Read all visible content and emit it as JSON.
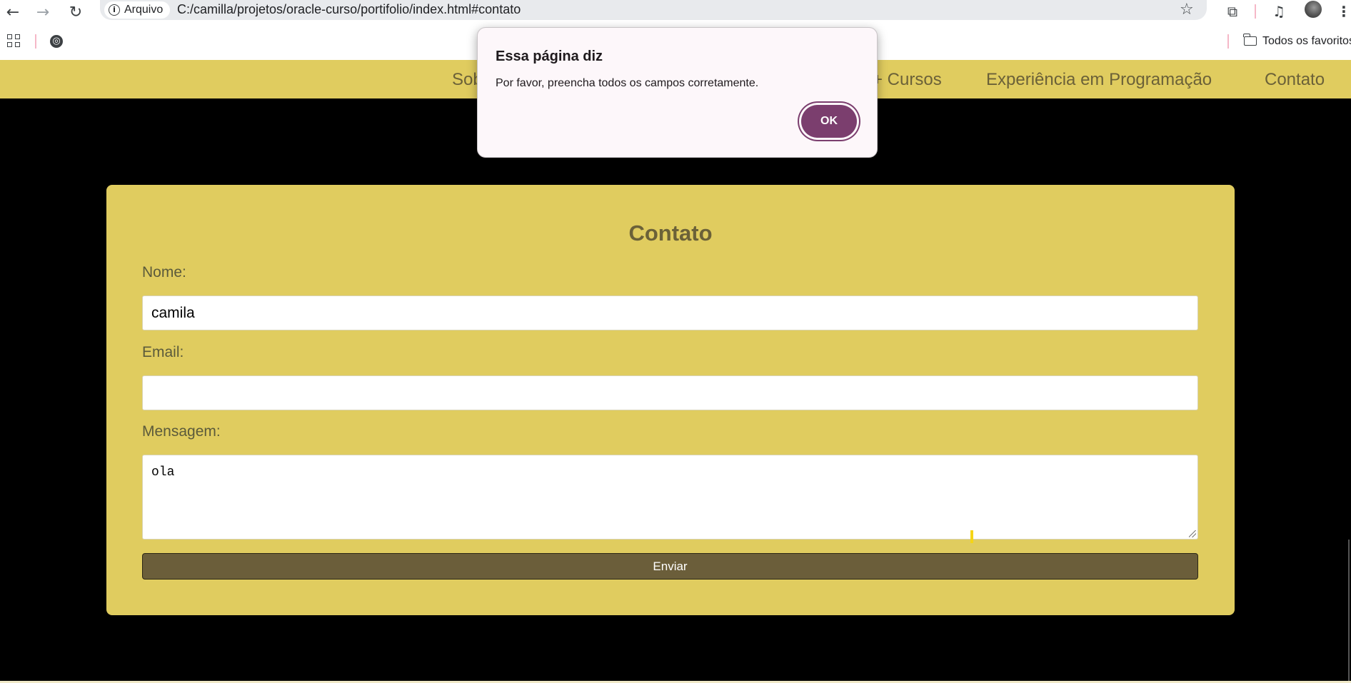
{
  "browser": {
    "site_info_label": "Arquivo",
    "url": "C:/camilla/projetos/oracle-curso/portifolio/index.html#contato",
    "bookmarks_folder": "Todos os favoritos"
  },
  "nav": {
    "items": [
      "Sobre",
      "+ Cursos",
      "Experiência em Programação",
      "Contato"
    ]
  },
  "contact": {
    "title": "Contato",
    "name_label": "Nome:",
    "name_value": "camila",
    "email_label": "Email:",
    "email_value": "",
    "message_label": "Mensagem:",
    "message_value": "ola",
    "submit_label": "Enviar"
  },
  "alert": {
    "title": "Essa página diz",
    "message": "Por favor, preencha todos os campos corretamente.",
    "ok_label": "OK"
  },
  "colors": {
    "nav_bg": "#e0cc5f",
    "card_bg": "#e0cc5f",
    "accent_text": "#6b6138",
    "submit_bg": "#6b5e3a",
    "ok_button": "#7b3e6e",
    "page_bg": "#000000"
  }
}
